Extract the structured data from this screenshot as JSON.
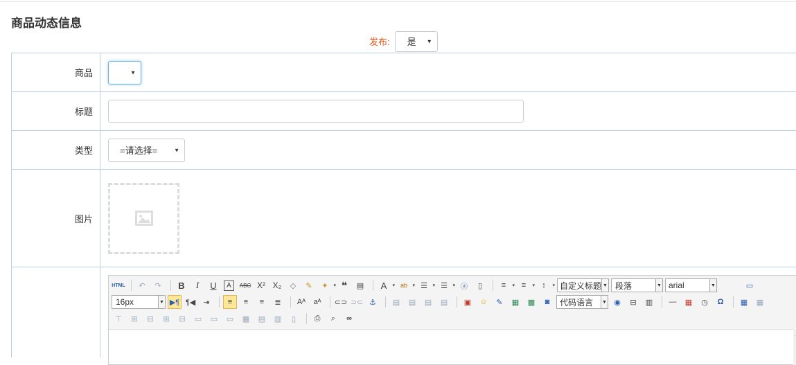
{
  "page": {
    "title": "商品动态信息"
  },
  "publish": {
    "label": "发布:",
    "value": "是"
  },
  "form": {
    "product": {
      "label": "商品",
      "value": ""
    },
    "headline": {
      "label": "标题",
      "value": ""
    },
    "type": {
      "label": "类型",
      "value": "=请选择="
    },
    "image": {
      "label": "图片"
    }
  },
  "editor": {
    "toolbar": {
      "html_label": "HTML",
      "custom_heading": "自定义标题",
      "paragraph": "段落",
      "font_family": "arial",
      "font_size": "16px",
      "code_language": "代码语言"
    }
  },
  "colors": {
    "accent_label": "#e0531a",
    "border": "#b8cfe0",
    "focus": "#66afe9"
  }
}
